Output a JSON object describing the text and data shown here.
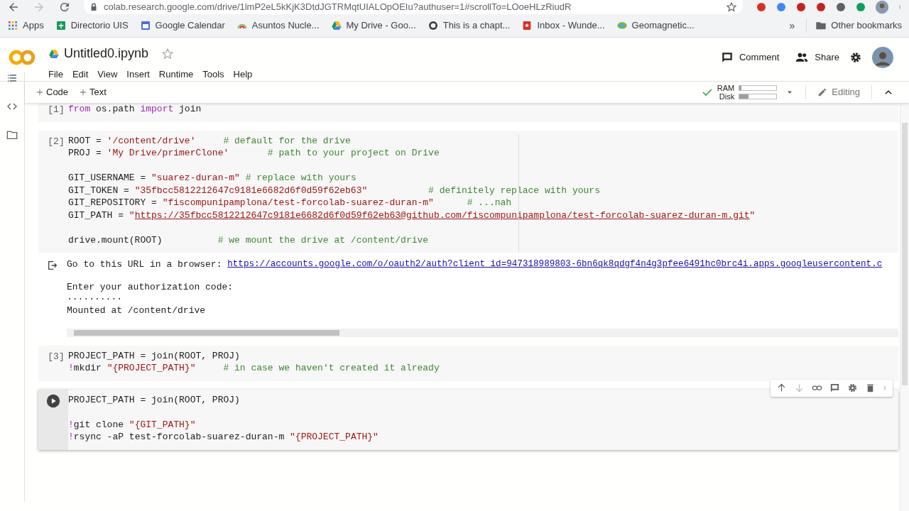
{
  "browser": {
    "url": "colab.research.google.com/drive/1lmP2eL5kKjK3DtdJGTRMqtUIALOpOEIu?authuser=1#scrollTo=LOoeHLzRiudR",
    "bookmarks": [
      {
        "label": "Apps"
      },
      {
        "label": "Directorio UIS"
      },
      {
        "label": "Google Calendar"
      },
      {
        "label": "Asuntos Nucle..."
      },
      {
        "label": "My Drive - Goo..."
      },
      {
        "label": "This is a chapt..."
      },
      {
        "label": "Inbox - Wunde..."
      },
      {
        "label": "Geomagnetic..."
      }
    ],
    "more": "»",
    "other_bookmarks": "Other bookmarks"
  },
  "notebook": {
    "title": "Untitled0.ipynb",
    "starred": false,
    "menu": [
      "File",
      "Edit",
      "View",
      "Insert",
      "Runtime",
      "Tools",
      "Help"
    ],
    "comment": "Comment",
    "share": "Share"
  },
  "toolbar": {
    "add_code": "Code",
    "add_text": "Text",
    "ram": {
      "label": "RAM",
      "level": 0.05
    },
    "disk": {
      "label": "Disk",
      "level": 0.25
    },
    "mode": "Editing"
  },
  "cells": [
    {
      "prompt": "[1]",
      "selected": false,
      "lines": [
        {
          "tokens": [
            {
              "kind": "keyword",
              "text": "from"
            },
            {
              "kind": "plain",
              "text": " os.path "
            },
            {
              "kind": "keyword",
              "text": "import"
            },
            {
              "kind": "plain",
              "text": " join"
            }
          ]
        }
      ]
    },
    {
      "prompt": "[2]",
      "selected": false,
      "lines": [
        {
          "tokens": [
            {
              "kind": "plain",
              "text": "ROOT = "
            },
            {
              "kind": "string",
              "text": "'/content/drive'"
            },
            {
              "kind": "comment",
              "text": "     # default for the drive"
            }
          ]
        },
        {
          "tokens": [
            {
              "kind": "plain",
              "text": "PROJ = "
            },
            {
              "kind": "string",
              "text": "'My Drive/primerClone'"
            },
            {
              "kind": "comment",
              "text": "       # path to your project on Drive"
            }
          ]
        },
        {
          "kind": "blank"
        },
        {
          "tokens": [
            {
              "kind": "plain",
              "text": "GIT_USERNAME = "
            },
            {
              "kind": "string",
              "text": "\"suarez-duran-m\""
            },
            {
              "kind": "comment",
              "text": " # replace with yours"
            }
          ]
        },
        {
          "tokens": [
            {
              "kind": "plain",
              "text": "GIT_TOKEN = "
            },
            {
              "kind": "string",
              "text": "\"35fbcc5812212647c9181e6682d6f0d59f62eb63\""
            },
            {
              "kind": "comment",
              "text": "           # definitely replace with yours"
            }
          ]
        },
        {
          "tokens": [
            {
              "kind": "plain",
              "text": "GIT_REPOSITORY = "
            },
            {
              "kind": "string",
              "text": "\"fiscompunipamplona/test-forcolab-suarez-duran-m\""
            },
            {
              "kind": "comment",
              "text": "      # ...nah"
            }
          ]
        },
        {
          "tokens": [
            {
              "kind": "plain",
              "text": "GIT_PATH = "
            },
            {
              "kind": "string",
              "text": "\""
            },
            {
              "kind": "url",
              "text": "https://35fbcc5812212647c9181e6682d6f0d59f62eb63@github.com/fiscompunipamplona/test-forcolab-suarez-duran-m.git"
            },
            {
              "kind": "string",
              "text": "\""
            }
          ]
        },
        {
          "kind": "blank"
        },
        {
          "tokens": [
            {
              "kind": "plain",
              "text": "drive.mount(ROOT)"
            },
            {
              "kind": "comment",
              "text": "          # we mount the drive at /content/drive"
            }
          ]
        }
      ],
      "output": {
        "prompt_text": "Go to this URL in a browser: ",
        "link": "https://accounts.google.com/o/oauth2/auth?client_id=947318989803-6bn6qk8qdgf4n4g3pfee6491hc0brc4i.apps.googleusercontent.c",
        "lines": [
          {
            "kind": "blank"
          },
          {
            "text": "Enter your authorization code:"
          },
          {
            "text": "··········"
          },
          {
            "text": "Mounted at /content/drive"
          }
        ]
      }
    },
    {
      "prompt": "[3]",
      "selected": false,
      "lines": [
        {
          "tokens": [
            {
              "kind": "plain",
              "text": "PROJECT_PATH = join(ROOT, PROJ)"
            }
          ]
        },
        {
          "tokens": [
            {
              "kind": "keyword",
              "text": "!"
            },
            {
              "kind": "plain",
              "text": "mkdir "
            },
            {
              "kind": "string",
              "text": "\"{PROJECT_PATH}\""
            },
            {
              "kind": "comment",
              "text": "     # in case we haven't created it already"
            }
          ]
        }
      ]
    },
    {
      "selected": true,
      "lines": [
        {
          "tokens": [
            {
              "kind": "plain",
              "text": "PROJECT_PATH = join(ROOT, PROJ)"
            }
          ]
        },
        {
          "kind": "blank"
        },
        {
          "tokens": [
            {
              "kind": "keyword",
              "text": "!"
            },
            {
              "kind": "plain",
              "text": "git clone "
            },
            {
              "kind": "string",
              "text": "\"{GIT_PATH}\""
            }
          ]
        },
        {
          "tokens": [
            {
              "kind": "keyword",
              "text": "!"
            },
            {
              "kind": "plain",
              "text": "rsync -aP test-forcolab-suarez-duran-m "
            },
            {
              "kind": "string",
              "text": "\"{PROJECT_PATH}\""
            }
          ]
        }
      ]
    }
  ]
}
